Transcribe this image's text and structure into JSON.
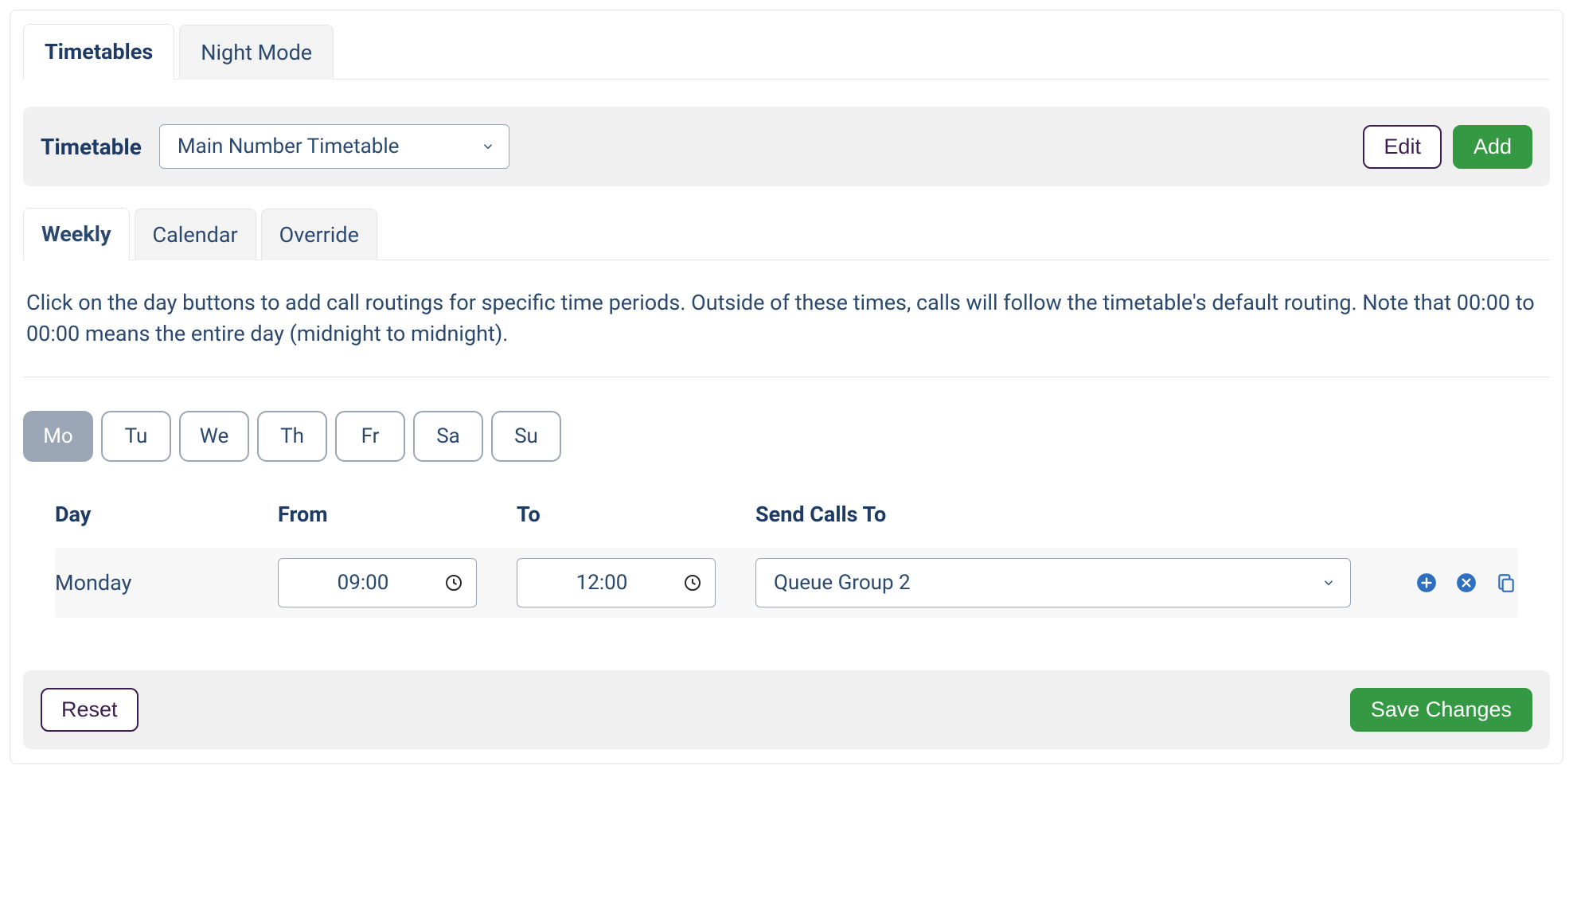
{
  "topTabs": {
    "timetables": "Timetables",
    "nightMode": "Night Mode",
    "active": "timetables"
  },
  "timetableBar": {
    "label": "Timetable",
    "selected": "Main Number Timetable",
    "edit": "Edit",
    "add": "Add"
  },
  "subTabs": {
    "weekly": "Weekly",
    "calendar": "Calendar",
    "override": "Override",
    "active": "weekly"
  },
  "description": "Click on the day buttons to add call routings for specific time periods. Outside of these times, calls will follow the timetable's default routing. Note that 00:00 to 00:00 means the entire day (midnight to midnight).",
  "days": [
    "Mo",
    "Tu",
    "We",
    "Th",
    "Fr",
    "Sa",
    "Su"
  ],
  "activeDayIndex": 0,
  "columns": {
    "day": "Day",
    "from": "From",
    "to": "To",
    "sendTo": "Send Calls To"
  },
  "rows": [
    {
      "day": "Monday",
      "from": "09:00",
      "to": "12:00",
      "sendTo": "Queue Group 2"
    }
  ],
  "bottomBar": {
    "reset": "Reset",
    "save": "Save Changes"
  }
}
